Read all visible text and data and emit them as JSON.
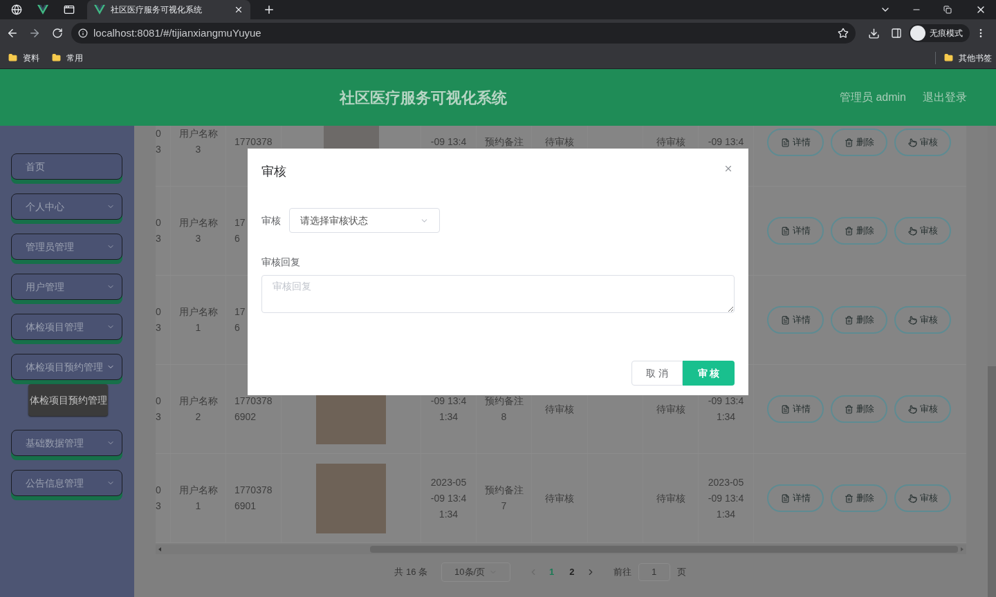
{
  "browser": {
    "tab_title": "社区医疗服务可视化系统",
    "url": "localhost:8081/#/tijianxiangmuYuyue",
    "profile": "无痕模式",
    "bookmarks": [
      "资料",
      "常用"
    ],
    "other_bookmarks": "其他书签"
  },
  "header": {
    "title": "社区医疗服务可视化系统",
    "user": "管理员 admin",
    "logout": "退出登录"
  },
  "sidebar": {
    "items": [
      {
        "label": "首页",
        "expandable": false
      },
      {
        "label": "个人中心",
        "expandable": true,
        "expanded": false
      },
      {
        "label": "管理员管理",
        "expandable": true,
        "expanded": false
      },
      {
        "label": "用户管理",
        "expandable": true,
        "expanded": false
      },
      {
        "label": "体检项目管理",
        "expandable": true,
        "expanded": false
      },
      {
        "label": "体检项目预约管理",
        "expandable": true,
        "expanded": true,
        "children": [
          {
            "label": "体检项目预约管理"
          }
        ]
      },
      {
        "label": "基础数据管理",
        "expandable": true,
        "expanded": false
      },
      {
        "label": "公告信息管理",
        "expandable": true,
        "expanded": false
      }
    ]
  },
  "table": {
    "rows": [
      {
        "column_1": "0\n3",
        "column_2": "用户名称\n3",
        "column_3": "1770378",
        "photo": true,
        "column_5": "-09 13:4",
        "column_6": "预约备注",
        "column_7": "待审核",
        "column_9": "待审核",
        "column_10": "-09 13:4",
        "actions": [
          "详情",
          "删除",
          "审核"
        ]
      },
      {
        "column_1": "0\n3",
        "column_2": "用户名称\n3",
        "column_3": "17\n6",
        "actions": [
          "详情",
          "删除",
          "审核"
        ]
      },
      {
        "column_1": "0\n3",
        "column_2": "用户名称\n1",
        "column_3": "17\n6",
        "actions": [
          "详情",
          "删除",
          "审核"
        ]
      },
      {
        "column_1": "0\n3",
        "column_2": "用户名称\n2",
        "column_3": "1770378\n6902",
        "photo": true,
        "column_5": "-09 13:4\n1:34",
        "column_6": "预约备注\n8",
        "column_7": "待审核",
        "column_9": "待审核",
        "column_10": "-09 13:4\n1:34",
        "actions": [
          "详情",
          "删除",
          "审核"
        ]
      },
      {
        "column_1": "0\n3",
        "column_2": "用户名称\n1",
        "column_3": "1770378\n6901",
        "photo": true,
        "column_5": "2023-05\n-09 13:4\n1:34",
        "column_6": "预约备注\n7",
        "column_7": "待审核",
        "column_9": "待审核",
        "column_10": "2023-05\n-09 13:4\n1:34",
        "actions": [
          "详情",
          "删除",
          "审核"
        ]
      }
    ]
  },
  "pagination": {
    "total": "共 16 条",
    "page_size": "10条/页",
    "pages": [
      {
        "label": "1",
        "selected": true
      },
      {
        "label": "2",
        "selected": false
      }
    ],
    "goto_label": "前往",
    "goto_value": "1",
    "page_suffix": "页"
  },
  "dialog": {
    "title": "审核",
    "status_label": "审核",
    "status_placeholder": "请选择审核状态",
    "reply_label": "审核回复",
    "reply_placeholder": "审核回复",
    "cancel": "取 消",
    "confirm": "审 核"
  }
}
